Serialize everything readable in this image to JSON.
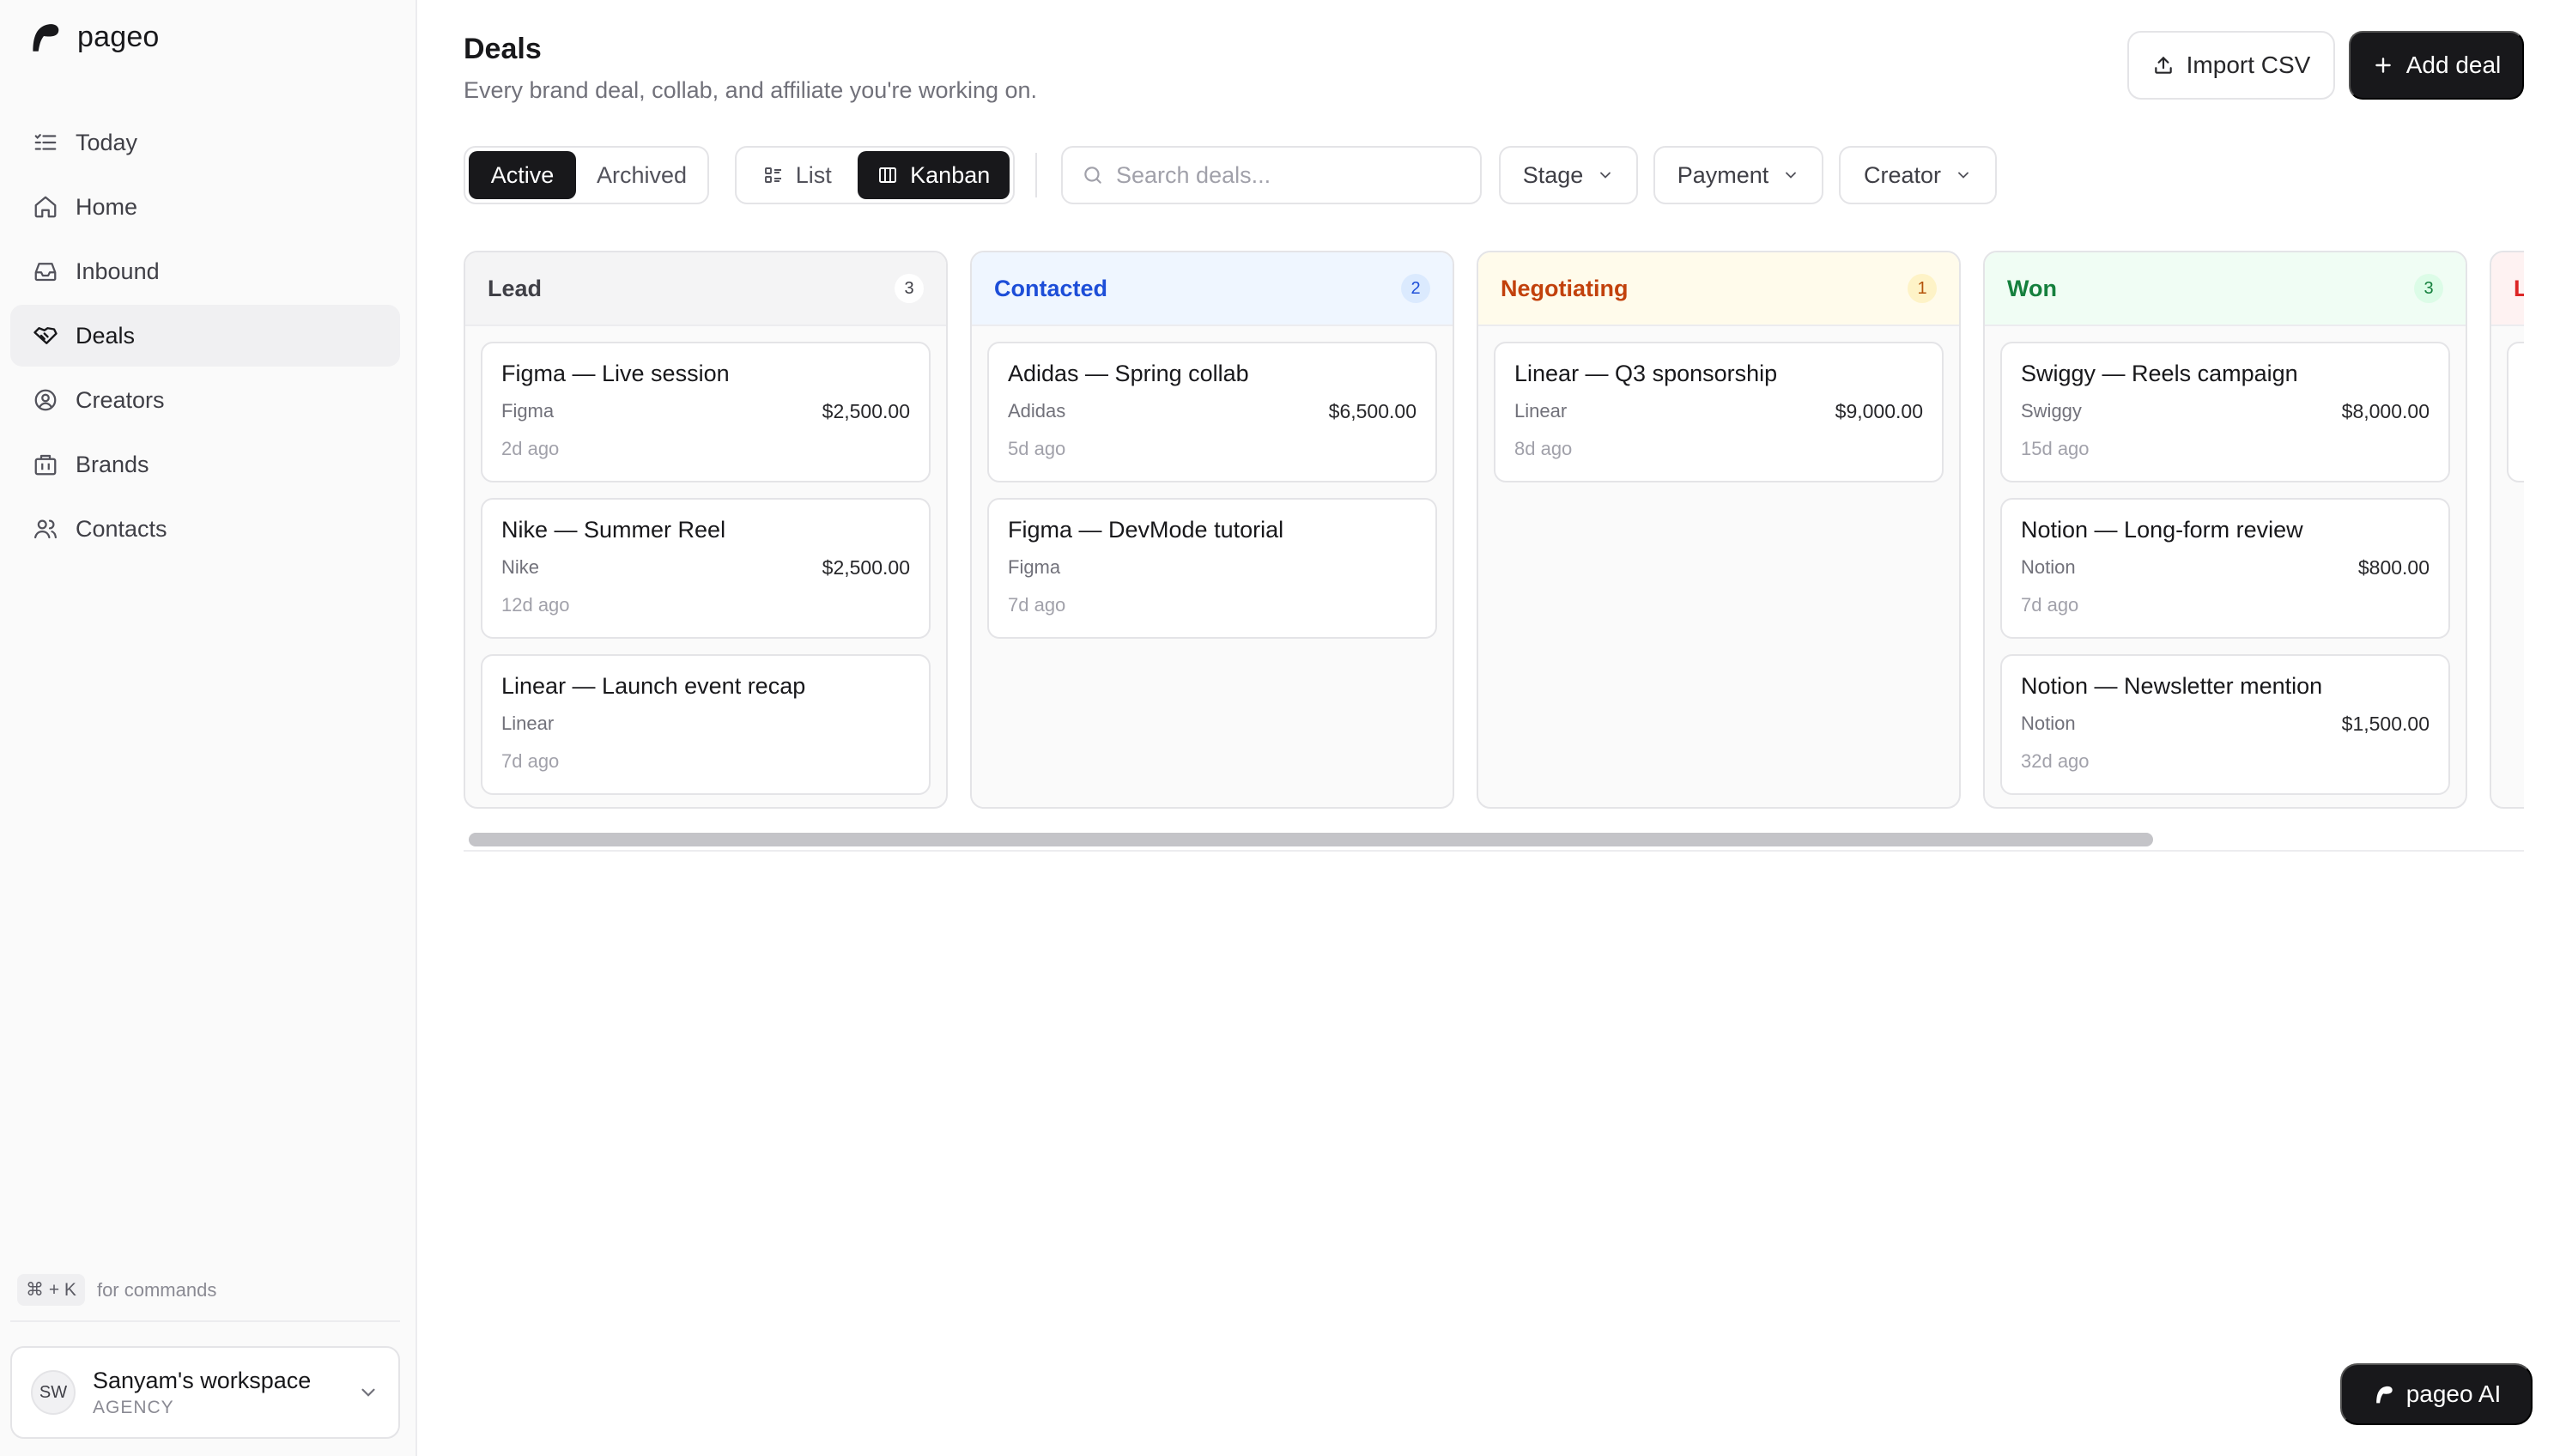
{
  "app": {
    "name": "pageo"
  },
  "sidebar": {
    "items": [
      {
        "label": "Today",
        "icon": "list-check-icon"
      },
      {
        "label": "Home",
        "icon": "home-icon"
      },
      {
        "label": "Inbound",
        "icon": "inbox-icon"
      },
      {
        "label": "Deals",
        "icon": "handshake-icon",
        "active": true
      },
      {
        "label": "Creators",
        "icon": "user-circle-icon"
      },
      {
        "label": "Brands",
        "icon": "building-icon"
      },
      {
        "label": "Contacts",
        "icon": "users-icon"
      }
    ],
    "cmd_hint": {
      "keys": "⌘ + K",
      "text": "for commands"
    },
    "workspace": {
      "initials": "SW",
      "name": "Sanyam's workspace",
      "role": "AGENCY"
    }
  },
  "header": {
    "title": "Deals",
    "subtitle": "Every brand deal, collab, and affiliate you're working on.",
    "import_label": "Import CSV",
    "add_label": "Add deal"
  },
  "toolbar": {
    "scope_tabs": [
      {
        "label": "Active",
        "active": true
      },
      {
        "label": "Archived",
        "active": false
      }
    ],
    "view_tabs": [
      {
        "label": "List",
        "active": false
      },
      {
        "label": "Kanban",
        "active": true
      }
    ],
    "search_placeholder": "Search deals...",
    "search_value": "",
    "filters": [
      {
        "label": "Stage"
      },
      {
        "label": "Payment"
      },
      {
        "label": "Creator"
      }
    ]
  },
  "board": {
    "columns": [
      {
        "name": "Lead",
        "count": "3",
        "colors": {
          "text": "#3f3f46",
          "head_bg": "#f4f4f5",
          "badge_bg": "#ffffff",
          "badge_text": "#3f3f46"
        },
        "cards": [
          {
            "title": "Figma — Live session",
            "brand": "Figma",
            "amount": "$2,500.00",
            "age": "2d ago"
          },
          {
            "title": "Nike — Summer Reel",
            "brand": "Nike",
            "amount": "$2,500.00",
            "age": "12d ago"
          },
          {
            "title": "Linear — Launch event recap",
            "brand": "Linear",
            "amount": "",
            "age": "7d ago"
          }
        ]
      },
      {
        "name": "Contacted",
        "count": "2",
        "colors": {
          "text": "#1d4ed8",
          "head_bg": "#eff6ff",
          "badge_bg": "#dbeafe",
          "badge_text": "#1d4ed8"
        },
        "cards": [
          {
            "title": "Adidas — Spring collab",
            "brand": "Adidas",
            "amount": "$6,500.00",
            "age": "5d ago"
          },
          {
            "title": "Figma — DevMode tutorial",
            "brand": "Figma",
            "amount": "",
            "age": "7d ago"
          }
        ]
      },
      {
        "name": "Negotiating",
        "count": "1",
        "colors": {
          "text": "#c2410c",
          "head_bg": "#fffbeb",
          "badge_bg": "#fef3c7",
          "badge_text": "#b45309"
        },
        "cards": [
          {
            "title": "Linear — Q3 sponsorship",
            "brand": "Linear",
            "amount": "$9,000.00",
            "age": "8d ago"
          }
        ]
      },
      {
        "name": "Won",
        "count": "3",
        "colors": {
          "text": "#15803d",
          "head_bg": "#f0fdf4",
          "badge_bg": "#dcfce7",
          "badge_text": "#15803d"
        },
        "cards": [
          {
            "title": "Swiggy — Reels campaign",
            "brand": "Swiggy",
            "amount": "$8,000.00",
            "age": "15d ago"
          },
          {
            "title": "Notion — Long-form review",
            "brand": "Notion",
            "amount": "$800.00",
            "age": "7d ago"
          },
          {
            "title": "Notion — Newsletter mention",
            "brand": "Notion",
            "amount": "$1,500.00",
            "age": "32d ago"
          }
        ]
      },
      {
        "name": "L",
        "count": "",
        "colors": {
          "text": "#dc2626",
          "head_bg": "#fef2f2",
          "badge_bg": "#fee2e2",
          "badge_text": "#dc2626"
        },
        "cards": [
          {
            "title": "",
            "brand": "",
            "amount": "",
            "age": ""
          }
        ]
      }
    ]
  },
  "ai_button": {
    "label": "pageo AI"
  }
}
